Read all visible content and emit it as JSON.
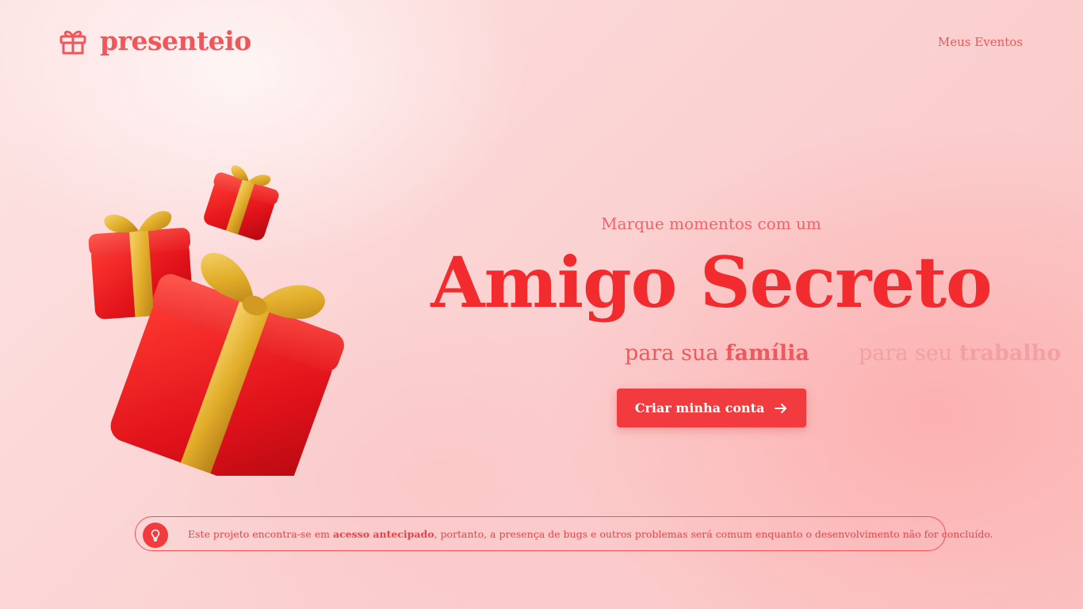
{
  "brand": {
    "name": "presenteio",
    "icon": "gift-icon",
    "color": "#f0565a"
  },
  "nav": {
    "my_events": "Meus Eventos"
  },
  "hero": {
    "tagline": "Marque momentos com um",
    "title": "Amigo Secreto",
    "audiences": [
      {
        "prefix": "para sua ",
        "bold": "família"
      },
      {
        "prefix": "para seu ",
        "bold": "trabalho"
      }
    ],
    "cta_label": "Criar minha conta",
    "cta_icon": "arrow-right-icon",
    "illustration_icon": "gift-boxes-illustration"
  },
  "notice": {
    "icon": "lightbulb-icon",
    "text_before": "Este projeto encontra-se em ",
    "text_bold": "acesso antecipado",
    "text_after": ", portanto, a presença de bugs e outros problemas será comum enquanto o desenvolvimento não for concluído."
  },
  "colors": {
    "accent": "#f23b3e",
    "title": "#f22b2f",
    "gold": "#e4b12a"
  }
}
